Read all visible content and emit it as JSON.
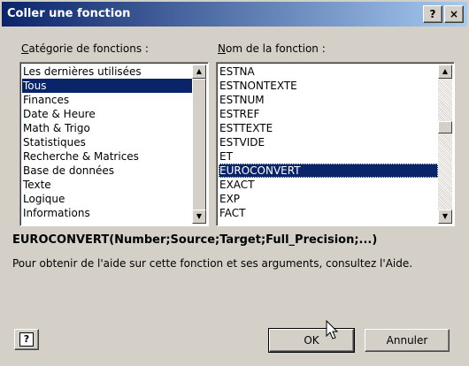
{
  "window": {
    "title": "Coller une fonction",
    "help_glyph": "?",
    "close_glyph": "×"
  },
  "category": {
    "label_first": "C",
    "label_rest": "atégorie de fonctions :",
    "items": [
      "Les dernières utilisées",
      "Tous",
      "Finances",
      "Date & Heure",
      "Math & Trigo",
      "Statistiques",
      "Recherche & Matrices",
      "Base de données",
      "Texte",
      "Logique",
      "Informations"
    ],
    "selected": "Tous"
  },
  "function": {
    "label_first": "N",
    "label_rest": "om de la fonction :",
    "items": [
      "ESTNA",
      "ESTNONTEXTE",
      "ESTNUM",
      "ESTREF",
      "ESTTEXTE",
      "ESTVIDE",
      "ET",
      "EUROCONVERT",
      "EXACT",
      "EXP",
      "FACT"
    ],
    "selected": "EUROCONVERT"
  },
  "syntax": "EUROCONVERT(Number;Source;Target;Full_Precision;...)",
  "description": "Pour obtenir de l'aide sur cette fonction et ses arguments, consultez l'Aide.",
  "buttons": {
    "help_icon": "?",
    "ok": "OK",
    "cancel": "Annuler"
  },
  "icons": {
    "up": "▲",
    "down": "▼"
  }
}
